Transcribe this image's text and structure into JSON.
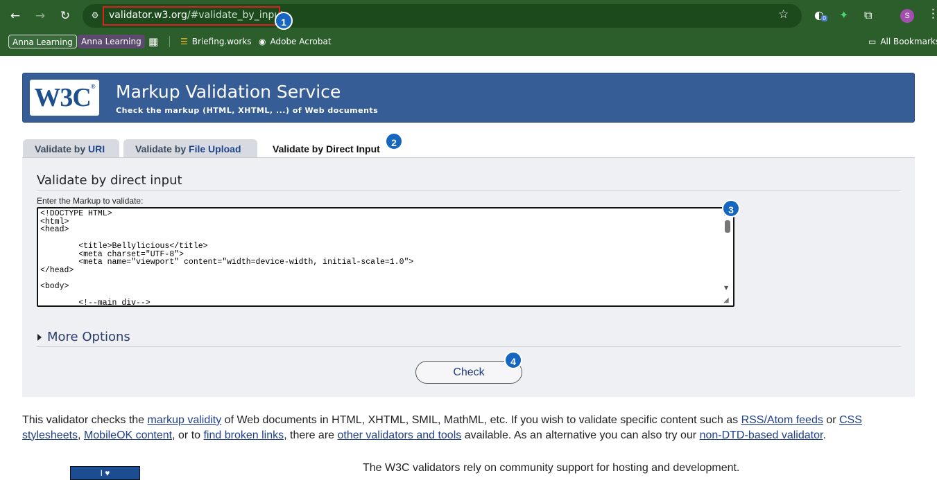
{
  "browser": {
    "url_host": "validator.w3.org",
    "url_path": "/#validate_by_input",
    "extension_badge": "0",
    "avatar_letter": "S",
    "bookmarks": [
      "Anna Learning",
      "Anna Learning",
      "Briefing.works",
      "Adobe Acrobat"
    ],
    "all_bookmarks": "All Bookmarks"
  },
  "markers": [
    "1",
    "2",
    "3",
    "4"
  ],
  "header": {
    "logo": "W3C",
    "logo_reg": "®",
    "title": "Markup Validation Service",
    "subtitle": "Check the markup (HTML, XHTML, ...) of Web documents"
  },
  "tabs": {
    "uri_prefix": "Validate by ",
    "uri_hl": "URI",
    "upload_prefix": "Validate by ",
    "upload_hl": "File Upload",
    "direct": "Validate by Direct Input"
  },
  "panel": {
    "heading": "Validate by direct input",
    "label": "Enter the Markup to validate:",
    "markup": "<!DOCTYPE HTML>\n<html>\n<head>\n\n        <title>Bellylicious</title>\n        <meta charset=\"UTF-8\">\n        <meta name=\"viewport\" content=\"width=device-width, initial-scale=1.0\">\n</head>\n\n<body>\n\n        <!--main div-->",
    "more_options": "More Options",
    "check_button": "Check"
  },
  "footer": {
    "p1": "This validator checks the ",
    "l1": "markup validity",
    "p2": " of Web documents in HTML, XHTML, SMIL, MathML, etc. If you wish to validate specific content such as ",
    "l2": "RSS/Atom feeds",
    "p3": " or ",
    "l3": "CSS stylesheets",
    "p4": ", ",
    "l4": "MobileOK content",
    "p5": ", or to ",
    "l5": "find broken links",
    "p6": ", there are ",
    "l6": "other validators and tools",
    "p7": " available. As an alternative you can also try our ",
    "l7": "non-DTD-based validator",
    "p8": ".",
    "support": "The W3C validators rely on community support for hosting and development.",
    "love_icon": "heart-icon"
  }
}
